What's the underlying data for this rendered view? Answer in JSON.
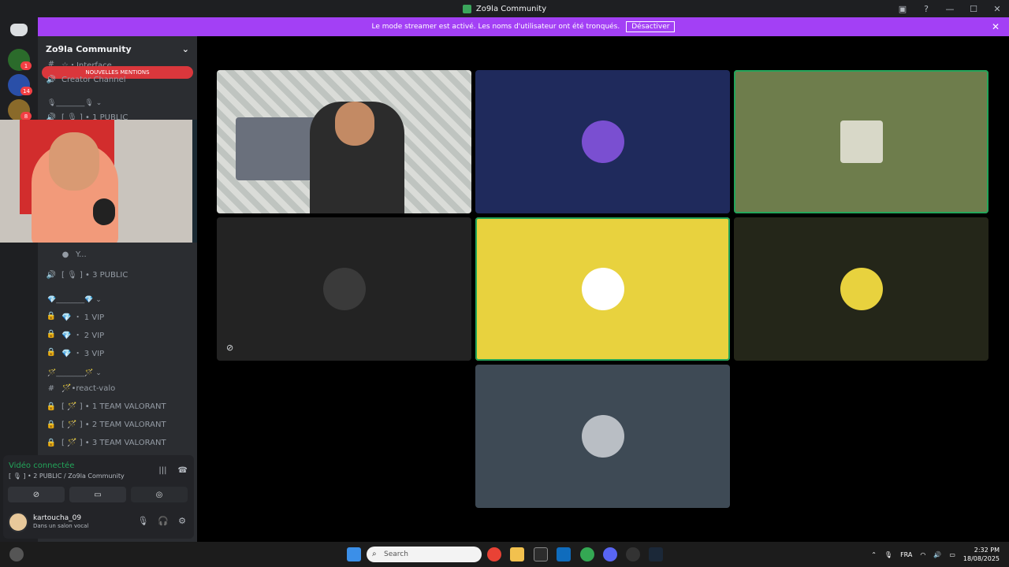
{
  "window": {
    "title": "Zo9la Community"
  },
  "banner": {
    "text": "Le mode streamer est activé. Les noms d'utilisateur ont été tronqués.",
    "button": "Désactiver"
  },
  "rail": {
    "badges": [
      "1",
      "14",
      "8"
    ]
  },
  "sidebar": {
    "guild_name": "Zo9la Community",
    "mentions_pill": "NOUVELLES MENTIONS",
    "channels": [
      {
        "icon": "#",
        "label": "☆・Interface"
      },
      {
        "icon": "🔊",
        "label": "Creator Channel"
      },
      {
        "icon": "",
        "label": "🎙________🎙 ⌄"
      },
      {
        "icon": "🔊",
        "label": "[ 🎙 ] • 1 PUBLIC"
      },
      {
        "icon": "",
        "label": "Y..."
      },
      {
        "icon": "🔊",
        "label": "[ 🎙 ] • 3 PUBLIC"
      },
      {
        "icon": "",
        "label": "💎________💎 ⌄"
      },
      {
        "icon": "🔒",
        "label": "💎 ・ 1 VIP"
      },
      {
        "icon": "🔒",
        "label": "💎 ・ 2 VIP"
      },
      {
        "icon": "🔒",
        "label": "💎 ・ 3 VIP"
      },
      {
        "icon": "",
        "label": "🪄________🪄 ⌄"
      },
      {
        "icon": "#",
        "label": "🪄•react-valo"
      },
      {
        "icon": "🔒",
        "label": "[ 🪄 ] • 1 TEAM VALORANT"
      },
      {
        "icon": "🔒",
        "label": "[ 🪄 ] • 2 TEAM VALORANT"
      },
      {
        "icon": "🔒",
        "label": "[ 🪄 ] • 3 TEAM VALORANT"
      }
    ],
    "voice": {
      "status": "Vidéo connectée",
      "channel": "[ 🎙 ] • 2 PUBLIC / Zo9la Community"
    },
    "user": {
      "name": "kartoucha_09",
      "status": "Dans un salon vocal"
    }
  },
  "taskbar": {
    "search_placeholder": "Search",
    "lang": "FRA",
    "time": "2:32 PM",
    "date": "18/08/2025"
  },
  "colors": {
    "accent": "#a340f5",
    "speaking": "#23a55a",
    "yellow_tile": "#e8d23e"
  }
}
